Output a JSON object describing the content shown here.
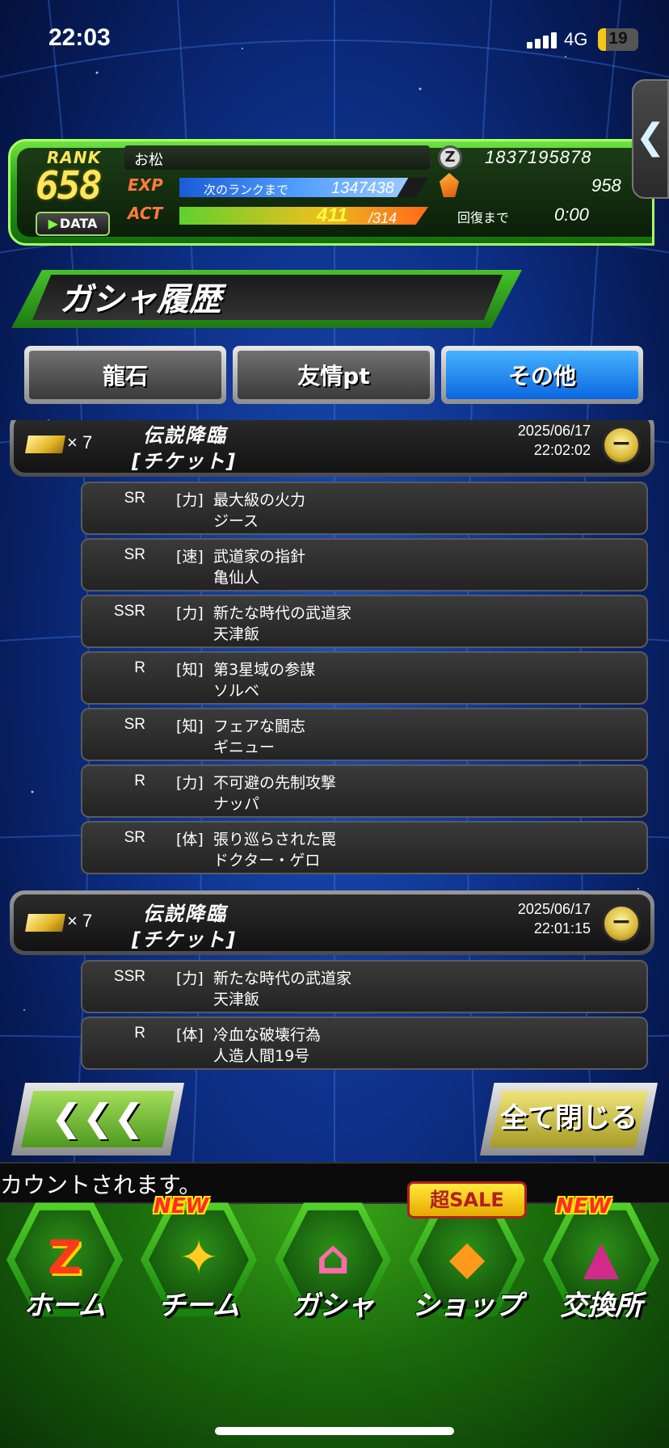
{
  "status_bar": {
    "time": "22:03",
    "network": "4G",
    "battery": "19",
    "battery_level": 0.19
  },
  "player": {
    "rank_label": "RANK",
    "rank": "658",
    "data_button": "DATA",
    "name": "お松",
    "exp_label": "EXP",
    "exp_next_label": "次のランクまで",
    "exp_remaining": "1347438",
    "exp_progress": 0.92,
    "act_label": "ACT",
    "act_current": "411",
    "act_max": "/314",
    "act_progress": 1.0,
    "zeni_icon": "Z",
    "zeni": "1837195878",
    "dragon_stones": "958",
    "recover_label": "回復まで",
    "recover_time": "0:00"
  },
  "side_tab": {
    "label": "❮"
  },
  "page": {
    "title": "ガシャ履歴"
  },
  "tabs": [
    {
      "label": "龍石",
      "active": false
    },
    {
      "label": "友情pt",
      "active": false
    },
    {
      "label": "その他",
      "active": true
    }
  ],
  "history": [
    {
      "ticket_count": "× 7",
      "banner_name": "伝説降臨",
      "banner_type": "[チケット]",
      "date": "2025/06/17",
      "time": "22:02:02",
      "collapse_icon": "−",
      "items": [
        {
          "rarity": "SR",
          "attribute": "[力]",
          "title": "最大級の火力",
          "name": "ジース"
        },
        {
          "rarity": "SR",
          "attribute": "[速]",
          "title": "武道家の指針",
          "name": "亀仙人"
        },
        {
          "rarity": "SSR",
          "attribute": "[力]",
          "title": "新たな時代の武道家",
          "name": "天津飯"
        },
        {
          "rarity": "R",
          "attribute": "[知]",
          "title": "第3星域の参謀",
          "name": "ソルベ"
        },
        {
          "rarity": "SR",
          "attribute": "[知]",
          "title": "フェアな闘志",
          "name": "ギニュー"
        },
        {
          "rarity": "R",
          "attribute": "[力]",
          "title": "不可避の先制攻撃",
          "name": "ナッパ"
        },
        {
          "rarity": "SR",
          "attribute": "[体]",
          "title": "張り巡らされた罠",
          "name": "ドクター・ゲロ"
        }
      ]
    },
    {
      "ticket_count": "× 7",
      "banner_name": "伝説降臨",
      "banner_type": "[チケット]",
      "date": "2025/06/17",
      "time": "22:01:15",
      "collapse_icon": "−",
      "items": [
        {
          "rarity": "SSR",
          "attribute": "[力]",
          "title": "新たな時代の武道家",
          "name": "天津飯"
        },
        {
          "rarity": "R",
          "attribute": "[体]",
          "title": "冷血な破壊行為",
          "name": "人造人間19号"
        }
      ]
    }
  ],
  "buttons": {
    "back": "❮❮❮",
    "close_all": "全て閉じる"
  },
  "ticker": "カウントされます。",
  "nav": [
    {
      "label": "ホーム",
      "icon": "Z",
      "badge": ""
    },
    {
      "label": "チーム",
      "icon": "✦",
      "badge": "NEW"
    },
    {
      "label": "ガシャ",
      "icon": "⌂",
      "badge": ""
    },
    {
      "label": "ショップ",
      "icon": "◆",
      "badge": "超SALE"
    },
    {
      "label": "交換所",
      "icon": "▲",
      "badge": "NEW"
    }
  ],
  "colors": {
    "accent_green": "#2aa21a",
    "active_tab": "#0a66e0",
    "rank_yellow": "#ffe65a"
  }
}
